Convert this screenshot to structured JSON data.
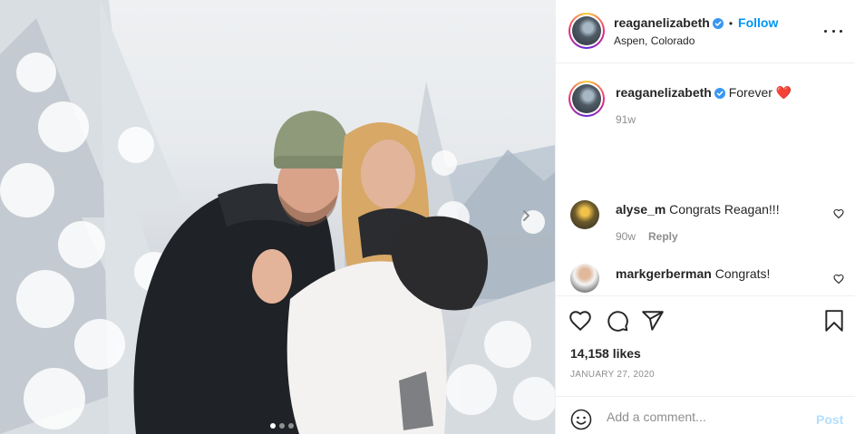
{
  "post": {
    "author": {
      "username": "reaganelizabeth",
      "verified": true,
      "location": "Aspen, Colorado",
      "follow_label": "Follow",
      "separator": "•"
    },
    "caption": {
      "username": "reaganelizabeth",
      "text": "Forever",
      "emoji": "❤️",
      "age": "91w"
    },
    "comments": [
      {
        "username": "alyse_m",
        "text": "Congrats Reagan!!!",
        "age": "90w",
        "reply_label": "Reply"
      },
      {
        "username": "markgerberman",
        "text": "Congrats!"
      }
    ],
    "likes": "14,158 likes",
    "date": "JANUARY 27, 2020",
    "composer": {
      "placeholder": "Add a comment...",
      "post_label": "Post"
    },
    "carousel": {
      "count": 3,
      "active_index": 0
    },
    "colors": {
      "accent": "#0095f6",
      "post_disabled": "#b2dffc",
      "verified": "#3897f0",
      "heart": "#ed4956"
    },
    "icons": [
      "verified-badge-icon",
      "more-options-icon",
      "heart-icon",
      "comment-icon",
      "share-icon",
      "bookmark-icon",
      "emoji-icon",
      "chevron-right-icon"
    ]
  }
}
